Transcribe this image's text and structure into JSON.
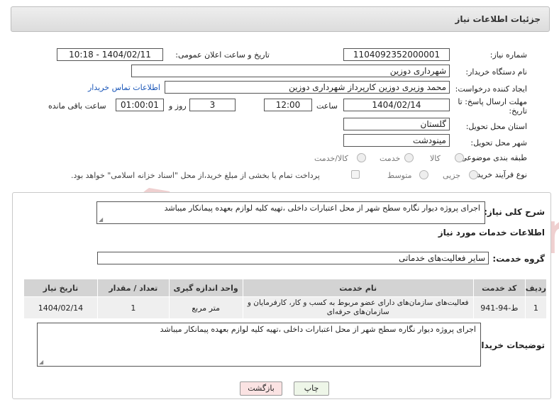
{
  "title": "جزئیات اطلاعات نیاز",
  "fields": {
    "need_number_label": "شماره نیاز:",
    "need_number": "1104092352000001",
    "announce_label": "تاریخ و ساعت اعلان عمومی:",
    "announce_value": "1404/02/11 - 10:18",
    "buyer_org_label": "نام دستگاه خریدار:",
    "buyer_org": "شهرداری دوزین",
    "creator_label": "ایجاد کننده درخواست:",
    "creator": "محمد وزیری دوزین کارپرداز شهرداری دوزین",
    "contact_link": "اطلاعات تماس خریدار",
    "deadline_label": "مهلت ارسال پاسخ: تا تاریخ:",
    "deadline_date": "1404/02/14",
    "time_label": "ساعت",
    "deadline_time": "12:00",
    "days_value": "3",
    "days_label": "روز و",
    "remaining_time": "01:00:01",
    "remaining_label": "ساعت باقی مانده",
    "province_label": "استان محل تحویل:",
    "province": "گلستان",
    "city_label": "شهر محل تحویل:",
    "city": "مینودشت",
    "category_label": "طبقه بندی موضوعی:",
    "category_options": [
      "کالا",
      "خدمت",
      "کالا/خدمت"
    ],
    "process_label": "نوع فرآیند خرید :",
    "process_options": [
      "جزیی",
      "متوسط"
    ],
    "payment_note": "پرداخت تمام یا بخشی از مبلغ خرید،از محل \"اسناد خزانه اسلامی\" خواهد بود."
  },
  "summary": {
    "label": "شرح کلی نیاز:",
    "text": "اجرای پروژه دیوار نگاره سطح شهر از محل اعتبارات داخلی ،تهیه کلیه لوازم بعهده پیمانکار میباشد"
  },
  "services": {
    "heading": "اطلاعات خدمات مورد نیاز",
    "group_label": "گروه خدمت:",
    "group_value": "سایر فعالیت‌های خدماتی",
    "columns": [
      "ردیف",
      "کد خدمت",
      "نام خدمت",
      "واحد اندازه گیری",
      "تعداد / مقدار",
      "تاریخ نیاز"
    ],
    "rows": [
      {
        "index": "1",
        "code": "ط-94-941",
        "name": "فعالیت‌های سازمان‌های دارای عضو مربوط به کسب و کار، کارفرمایان و سازمان‌های حرفه‌ای",
        "unit": "متر مربع",
        "qty": "1",
        "date": "1404/02/14"
      }
    ]
  },
  "buyer_notes": {
    "label": "توضیحات خریدار:",
    "text": "اجرای پروژه دیوار نگاره سطح شهر از محل اعتبارات داخلی ،تهیه کلیه لوازم بعهده پیمانکار میباشد"
  },
  "buttons": {
    "print": "چاپ",
    "back": "بازگشت"
  },
  "watermark": "AriaTender.net",
  "colors": {
    "link": "#1a56b8",
    "back_button": "#fbe3e3",
    "print_button": "#eef6e8",
    "watermark": "#e6b1b1"
  }
}
